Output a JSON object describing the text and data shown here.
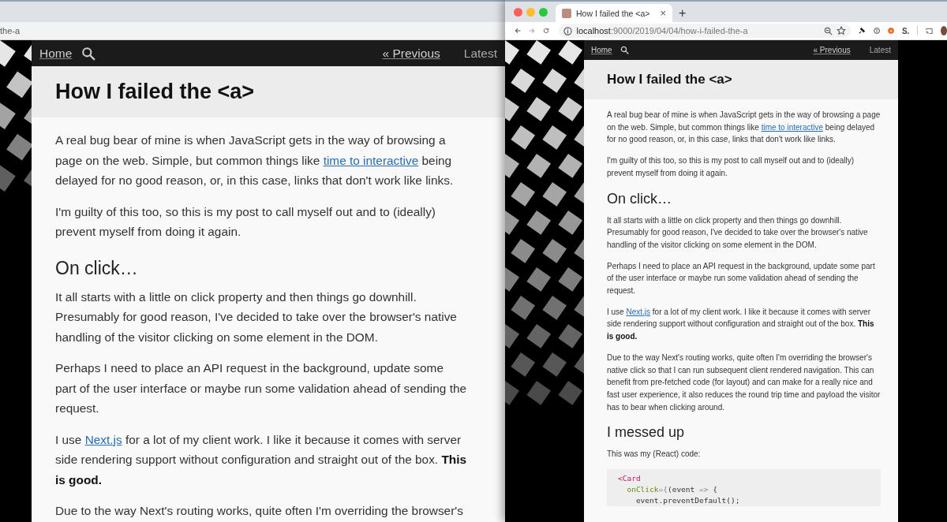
{
  "windows": [
    {
      "address_fragment": "the-a",
      "page": {
        "nav": {
          "home": "Home",
          "previous": "« Previous",
          "latest": "Latest"
        },
        "title": "How I failed the <a>",
        "blocks": [
          {
            "kind": "paragraph",
            "segments": [
              {
                "kind": "text",
                "text": "A real bug bear of mine is when JavaScript gets in the way of browsing a page on the web. Simple, but common things like "
              },
              {
                "kind": "link",
                "text": "time to interactive"
              },
              {
                "kind": "text",
                "text": " being delayed for no good reason, or, in this case, links that don't work like links."
              }
            ]
          },
          {
            "kind": "paragraph",
            "segments": [
              {
                "kind": "text",
                "text": "I'm guilty of this too, so this is my post to call myself out and to (ideally) prevent myself from doing it again."
              }
            ]
          },
          {
            "kind": "heading",
            "text": "On click…"
          },
          {
            "kind": "paragraph",
            "segments": [
              {
                "kind": "text",
                "text": "It all starts with a little on click property and then things go downhill. Presumably for good reason, I've decided to take over the browser's native handling of the visitor clicking on some element in the DOM."
              }
            ]
          },
          {
            "kind": "paragraph",
            "segments": [
              {
                "kind": "text",
                "text": "Perhaps I need to place an API request in the background, update some part of the user interface or maybe run some validation ahead of sending the request."
              }
            ]
          },
          {
            "kind": "paragraph",
            "segments": [
              {
                "kind": "text",
                "text": "I use "
              },
              {
                "kind": "link",
                "text": "Next.js"
              },
              {
                "kind": "text",
                "text": " for a lot of my client work. I like it because it comes with server side rendering support without configuration and straight out of the box. "
              },
              {
                "kind": "bold",
                "text": "This is good."
              }
            ]
          },
          {
            "kind": "paragraph",
            "segments": [
              {
                "kind": "text",
                "text": "Due to the way Next's routing works, quite often I'm overriding the browser's"
              }
            ]
          }
        ]
      }
    },
    {
      "tab": {
        "title": "How I failed the <a>",
        "close": "×"
      },
      "new_tab": "+",
      "address": {
        "host": "localhost",
        "rest": ":9000/2019/04/04/how-i-failed-the-a"
      },
      "extension_label": "S.",
      "page": {
        "nav": {
          "home": "Home",
          "previous": "« Previous",
          "latest": "Latest"
        },
        "title": "How I failed the <a>",
        "blocks": [
          {
            "kind": "paragraph",
            "segments": [
              {
                "kind": "text",
                "text": "A real bug bear of mine is when JavaScript gets in the way of browsing a page on the web. Simple, but common things like "
              },
              {
                "kind": "link",
                "text": "time to interactive"
              },
              {
                "kind": "text",
                "text": " being delayed for no good reason, or, in this case, links that don't work like links."
              }
            ]
          },
          {
            "kind": "paragraph",
            "segments": [
              {
                "kind": "text",
                "text": "I'm guilty of this too, so this is my post to call myself out and to (ideally) prevent myself from doing it again."
              }
            ]
          },
          {
            "kind": "heading",
            "text": "On click…"
          },
          {
            "kind": "paragraph",
            "segments": [
              {
                "kind": "text",
                "text": "It all starts with a little on click property and then things go downhill. Presumably for good reason, I've decided to take over the browser's native handling of the visitor clicking on some element in the DOM."
              }
            ]
          },
          {
            "kind": "paragraph",
            "segments": [
              {
                "kind": "text",
                "text": "Perhaps I need to place an API request in the background, update some part of the user interface or maybe run some validation ahead of sending the request."
              }
            ]
          },
          {
            "kind": "paragraph",
            "segments": [
              {
                "kind": "text",
                "text": "I use "
              },
              {
                "kind": "link",
                "text": "Next.js"
              },
              {
                "kind": "text",
                "text": " for a lot of my client work. I like it because it comes with server side rendering support without configuration and straight out of the box. "
              },
              {
                "kind": "bold",
                "text": "This is good."
              }
            ]
          },
          {
            "kind": "paragraph",
            "segments": [
              {
                "kind": "text",
                "text": "Due to the way Next's routing works, quite often I'm overriding the browser's native click so that I can run subsequent client rendered navigation. This can benefit from pre-fetched code (for layout) and can make for a really nice and fast user experience, it also reduces the round trip time and payload the visitor has to bear when clicking around."
              }
            ]
          },
          {
            "kind": "heading",
            "text": "I messed up"
          },
          {
            "kind": "paragraph",
            "segments": [
              {
                "kind": "text",
                "text": "This was my (React) code:"
              }
            ]
          },
          {
            "kind": "code",
            "lines": [
              [
                {
                  "kind": "tag",
                  "text": "<Card"
                }
              ],
              [
                {
                  "kind": "attr",
                  "text": "  onClick"
                },
                {
                  "kind": "punct",
                  "text": "={"
                },
                {
                  "kind": "plain",
                  "text": "(event "
                },
                {
                  "kind": "punct",
                  "text": "=>"
                },
                {
                  "kind": "plain",
                  "text": " {"
                }
              ],
              [
                {
                  "kind": "plain",
                  "text": "    event.preventDefault();"
                }
              ]
            ]
          }
        ]
      }
    }
  ]
}
